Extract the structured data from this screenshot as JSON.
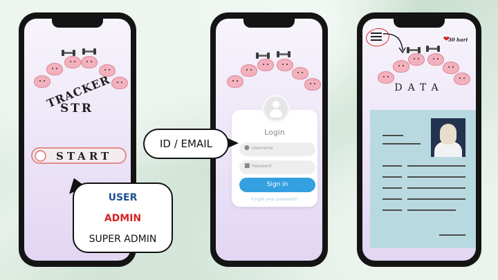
{
  "phone1": {
    "brand_line1": "TRACKER",
    "brand_line2": "STR",
    "start_label": "START"
  },
  "roles_bubble": {
    "roles": [
      {
        "label": "USER",
        "color": "#1d4f8f"
      },
      {
        "label": "ADMIN",
        "color": "#d12424"
      },
      {
        "label": "SUPER ADMIN",
        "color": "#111111"
      }
    ]
  },
  "id_bubble": {
    "label": "ID / EMAIL"
  },
  "phone2": {
    "login_title": "Login",
    "username_placeholder": "Username",
    "password_placeholder": "Password",
    "signin_label": "Sign in",
    "forgot_label": "Forgot your password?"
  },
  "phone3": {
    "days_label": "30 hari",
    "data_title": "DATA"
  },
  "colors": {
    "accent_blue": "#33a0e0",
    "start_border": "#e28a8a",
    "panel": "#b9d9e0"
  }
}
